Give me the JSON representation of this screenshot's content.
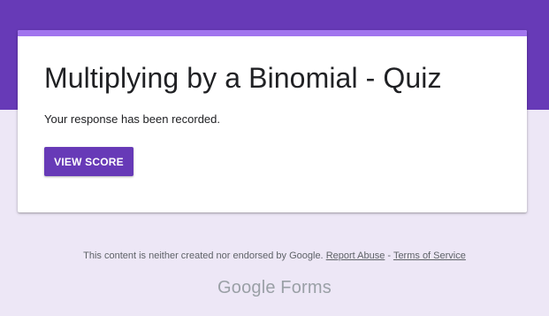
{
  "form": {
    "title": "Multiplying by a Binomial - Quiz",
    "confirmation_message": "Your response has been recorded.",
    "view_score_label": "VIEW SCORE"
  },
  "footer": {
    "disclaimer": "This content is neither created nor endorsed by Google.",
    "report_abuse": "Report Abuse",
    "separator": "-",
    "terms": "Terms of Service"
  },
  "brand": {
    "google": "Google",
    "product": "Forms"
  },
  "colors": {
    "accent": "#673ab7",
    "accent_light": "#a174ee",
    "page_background": "#ede7f6"
  }
}
